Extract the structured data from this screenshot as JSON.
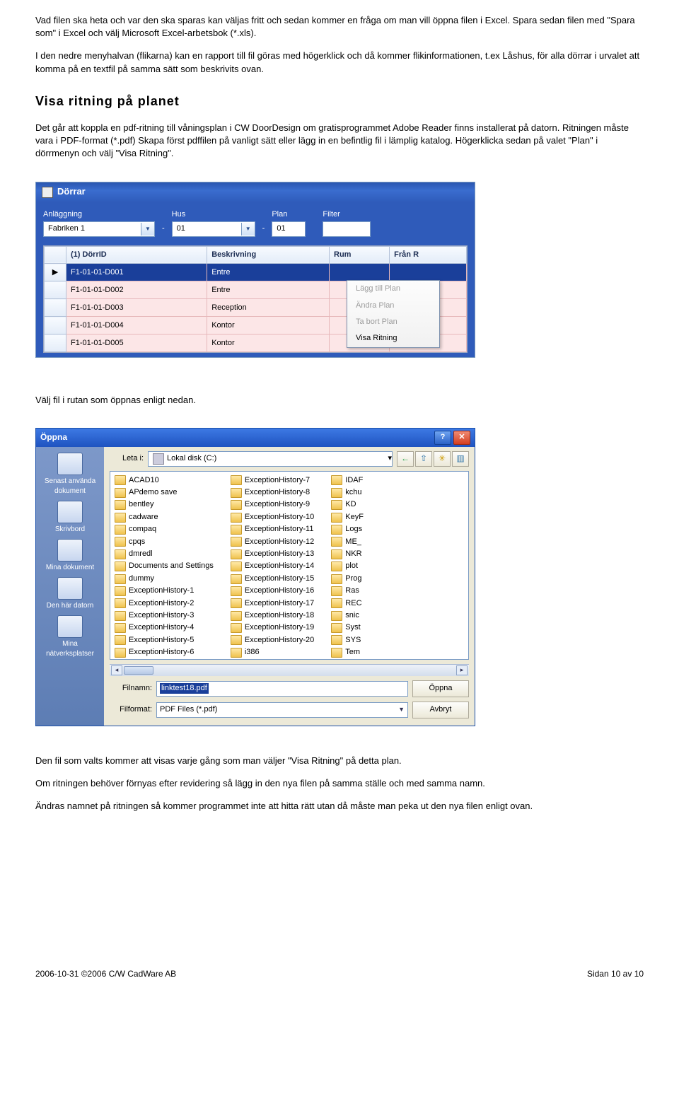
{
  "para1": "Vad filen ska heta och var den ska sparas kan väljas fritt och sedan kommer en fråga om man vill öppna filen i Excel. Spara sedan filen med \"Spara som\" i Excel och välj Microsoft Excel-arbetsbok (*.xls).",
  "para2": "I den nedre menyhalvan (flikarna) kan en rapport till fil göras med högerklick och då kommer flikinformationen, t.ex Låshus, för alla dörrar i urvalet att komma på en textfil på samma sätt som beskrivits ovan.",
  "heading1": "Visa ritning på planet",
  "para3": "Det går att koppla en pdf-ritning till våningsplan i CW DoorDesign om gratisprogrammet Adobe Reader finns installerat på datorn. Ritningen måste vara i PDF-format (*.pdf) Skapa först pdffilen på vanligt sätt eller lägg in en befintlig fil i lämplig katalog. Högerklicka sedan på valet \"Plan\" i dörrmenyn och välj \"Visa Ritning\".",
  "win1": {
    "title": "Dörrar",
    "filters": {
      "anlaggning": {
        "label": "Anläggning",
        "value": "Fabriken 1"
      },
      "hus": {
        "label": "Hus",
        "value": "01"
      },
      "plan": {
        "label": "Plan",
        "value": "01"
      },
      "filter": {
        "label": "Filter",
        "value": ""
      }
    },
    "columns": [
      "(1) DörrID",
      "Beskrivning",
      "Rum",
      "Från R"
    ],
    "rows": [
      {
        "id": "F1-01-01-D001",
        "besk": "Entre",
        "rum": "",
        "fr": ""
      },
      {
        "id": "F1-01-01-D002",
        "besk": "Entre",
        "rum": "",
        "fr": ""
      },
      {
        "id": "F1-01-01-D003",
        "besk": "Reception",
        "rum": "",
        "fr": ""
      },
      {
        "id": "F1-01-01-D004",
        "besk": "Kontor",
        "rum": "",
        "fr": ""
      },
      {
        "id": "F1-01-01-D005",
        "besk": "Kontor",
        "rum": "",
        "fr": ""
      }
    ],
    "ctx": {
      "add": "Lägg till Plan",
      "edit": "Ändra Plan",
      "del": "Ta bort Plan",
      "show": "Visa Ritning"
    }
  },
  "para4": "Välj fil i rutan som öppnas enligt nedan.",
  "win2": {
    "title": "Öppna",
    "lookin_label": "Leta i:",
    "lookin_value": "Lokal disk (C:)",
    "places": [
      "Senast använda dokument",
      "Skrivbord",
      "Mina dokument",
      "Den här datorn",
      "Mina nätverksplatser"
    ],
    "cols": [
      [
        "ACAD10",
        "APdemo save",
        "bentley",
        "cadware",
        "compaq",
        "cpqs",
        "dmredl",
        "Documents and Settings",
        "dummy",
        "ExceptionHistory-1",
        "ExceptionHistory-2",
        "ExceptionHistory-3",
        "ExceptionHistory-4",
        "ExceptionHistory-5",
        "ExceptionHistory-6"
      ],
      [
        "ExceptionHistory-7",
        "ExceptionHistory-8",
        "ExceptionHistory-9",
        "ExceptionHistory-10",
        "ExceptionHistory-11",
        "ExceptionHistory-12",
        "ExceptionHistory-13",
        "ExceptionHistory-14",
        "ExceptionHistory-15",
        "ExceptionHistory-16",
        "ExceptionHistory-17",
        "ExceptionHistory-18",
        "ExceptionHistory-19",
        "ExceptionHistory-20",
        "i386"
      ],
      [
        "IDAF",
        "kchu",
        "KD",
        "KeyF",
        "Logs",
        "ME_",
        "NKR",
        "plot",
        "Prog",
        "Ras",
        "REC",
        "snic",
        "Syst",
        "SYS",
        "Tem"
      ]
    ],
    "filename_label": "Filnamn:",
    "filename_value": "linktest18.pdf",
    "filetype_label": "Filformat:",
    "filetype_value": "PDF Files (*.pdf)",
    "open_btn": "Öppna",
    "cancel_btn": "Avbryt"
  },
  "para5": "Den fil som valts kommer att visas varje gång som man väljer \"Visa Ritning\" på detta plan.",
  "para6": "Om ritningen behöver förnyas efter revidering så lägg in den nya filen på samma ställe och med samma namn.",
  "para7": "Ändras namnet på ritningen så kommer programmet inte att hitta rätt utan då måste man peka ut den nya filen enligt ovan.",
  "footer": {
    "left": "2006-10-31 ©2006 C/W CadWare AB",
    "right": "Sidan 10 av 10"
  }
}
